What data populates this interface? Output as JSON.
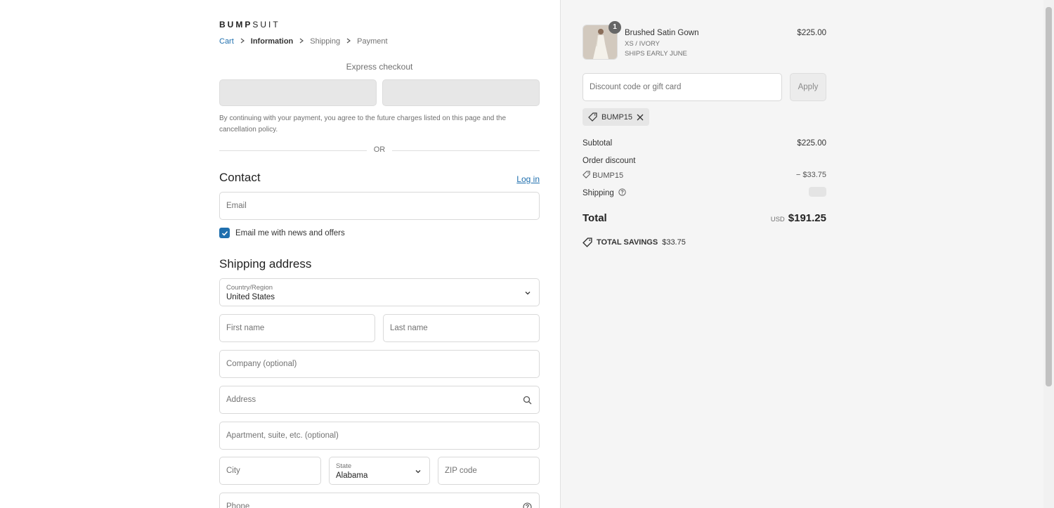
{
  "brand": {
    "logo_bold": "BUMP",
    "logo_light": "SUIT"
  },
  "breadcrumb": {
    "cart": "Cart",
    "information": "Information",
    "shipping": "Shipping",
    "payment": "Payment"
  },
  "express": {
    "title": "Express checkout"
  },
  "disclaimer": "By continuing with your payment, you agree to the future charges listed on this page and the cancellation policy.",
  "or_label": "OR",
  "contact": {
    "heading": "Contact",
    "login": "Log in",
    "email_placeholder": "Email",
    "newsletter_label": "Email me with news and offers",
    "newsletter_checked": true
  },
  "shipping_address": {
    "heading": "Shipping address",
    "country_label": "Country/Region",
    "country_value": "United States",
    "first_name": "First name",
    "last_name": "Last name",
    "company": "Company (optional)",
    "address": "Address",
    "apartment": "Apartment, suite, etc. (optional)",
    "city": "City",
    "state_label": "State",
    "state_value": "Alabama",
    "zip": "ZIP code",
    "phone": "Phone"
  },
  "order": {
    "item": {
      "quantity": "1",
      "name": "Brushed Satin Gown",
      "variant": "XS / IVORY",
      "note": "SHIPS EARLY JUNE",
      "price": "$225.00"
    },
    "discount_placeholder": "Discount code or gift card",
    "apply_label": "Apply",
    "applied_code": "BUMP15",
    "subtotal_label": "Subtotal",
    "subtotal_value": "$225.00",
    "order_discount_label": "Order discount",
    "discount_code": "BUMP15",
    "discount_value": "− $33.75",
    "shipping_label": "Shipping",
    "total_label": "Total",
    "currency": "USD",
    "total_value": "$191.25",
    "savings_label": "TOTAL SAVINGS",
    "savings_value": "$33.75"
  },
  "colors": {
    "link": "#1f6fae",
    "panel_bg": "#f5f5f5",
    "checkbox": "#1f6fae"
  }
}
